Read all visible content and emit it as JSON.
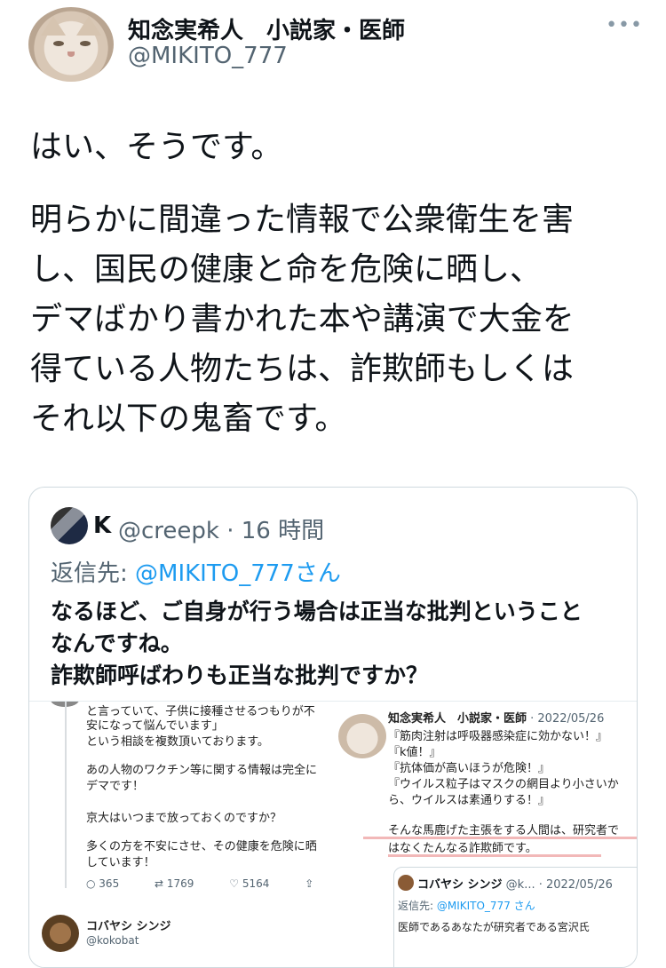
{
  "author": {
    "name": "知念実希人　小説家・医師",
    "handle": "@MIKITO_777"
  },
  "menu_icon": "more-horizontal-icon",
  "tweet": {
    "para1": "はい、そうです。",
    "para2": "明らかに間違った情報で公衆衛生を害\nし、国民の健康と命を危険に晒し、\nデマばかり書かれた本や講演で大金を\n得ている人物たちは、詐欺師もしくは\nそれ以下の鬼畜です。"
  },
  "quote": {
    "name": "K",
    "meta": " @creepk · 16 時間",
    "reply_prefix": "返信先: ",
    "reply_mention": "@MIKITO_777さん",
    "text": "なるほど、ご自身が行う場合は正当な批判ということ\nなんですね。\n詐欺師呼ばわりも正当な批判ですか？"
  },
  "screenshot": {
    "left_lines": [
      "と言っていて、子供に接種させるつもりが不",
      "安になって悩んでいます」",
      "という相談を複数頂いております。",
      "",
      "あの人物のワクチン等に関する情報は完全に",
      "デマです！",
      "",
      "京大はいつまで放っておくのですか？",
      "",
      "多くの方を不安にさせ、その健康を危険に晒",
      "しています！"
    ],
    "metrics": {
      "replies": "365",
      "retweets": "1769",
      "likes": "5164"
    },
    "reply_user": {
      "name": "コバヤシ シンジ",
      "handle": "@kokobat"
    },
    "right_header_name": "知念実希人　小説家・医師",
    "right_header_date": " · 2022/05/26",
    "right_lines": [
      "『筋肉注射は呼吸器感染症に効かない！』",
      "『k値！』",
      "『抗体価が高いほうが危険！』",
      "『ウイルス粒子はマスクの網目より小さいか",
      "ら、ウイルスは素通りする！』",
      "",
      "そんな馬鹿げた主張をする人間は、研究者で",
      "はなくたんなる詐欺師です。"
    ],
    "inner": {
      "name": "コバヤシ シンジ",
      "handle": " @k... · 2022/05/26",
      "reply_prefix": "返信先: ",
      "reply_mention": "@MIKITO_777 さん",
      "text": "医師であるあなたが研究者である宮沢氏"
    }
  }
}
